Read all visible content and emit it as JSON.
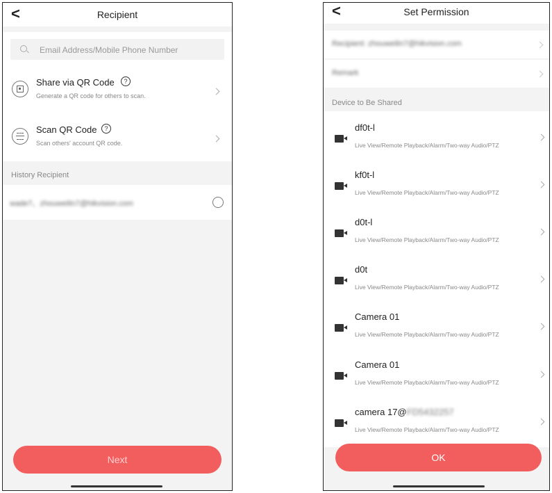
{
  "recipient_screen": {
    "title": "Recipient",
    "back_glyph": "<",
    "search": {
      "placeholder": "Email Address/Mobile Phone Number",
      "value": ""
    },
    "options": [
      {
        "title": "Share via QR Code",
        "subtitle": "Generate a QR code for others to scan.",
        "icon": "qr-code-icon"
      },
      {
        "title": "Scan QR Code",
        "subtitle": "Scan others' account QR code.",
        "icon": "scan-icon"
      }
    ],
    "history_label": "History Recipient",
    "history_items": [
      {
        "text": "wade7、zhouweilin7@hikvision.com",
        "selected": false
      }
    ],
    "help_glyph": "?",
    "next_label": "Next"
  },
  "permission_screen": {
    "title": "Set Permission",
    "back_glyph": "<",
    "recipient_row": "Recipient: zhouweilin7@hikvision.com",
    "remark_row": "Remark",
    "devices_label": "Device to Be Shared",
    "devices": [
      {
        "name": "df0t-l",
        "name_tail": "",
        "permissions": "Live View/Remote Playback/Alarm/Two-way Audio/PTZ"
      },
      {
        "name": "kf0t-l",
        "name_tail": "",
        "permissions": "Live View/Remote Playback/Alarm/Two-way Audio/PTZ"
      },
      {
        "name": "d0t-l",
        "name_tail": "",
        "permissions": "Live View/Remote Playback/Alarm/Two-way Audio/PTZ"
      },
      {
        "name": "d0t",
        "name_tail": "",
        "permissions": "Live View/Remote Playback/Alarm/Two-way Audio/PTZ"
      },
      {
        "name": "Camera 01",
        "name_tail": "",
        "permissions": "Live View/Remote Playback/Alarm/Two-way Audio/PTZ"
      },
      {
        "name": "Camera 01",
        "name_tail": "",
        "permissions": "Live View/Remote Playback/Alarm/Two-way Audio/PTZ"
      },
      {
        "name": "camera 17@",
        "name_tail": "FD5432257",
        "permissions": "Live View/Remote Playback/Alarm/Two-way Audio/PTZ"
      }
    ],
    "ok_label": "OK"
  },
  "colors": {
    "accent": "#f25d5d",
    "background": "#f3f3f3",
    "surface": "#ffffff"
  }
}
